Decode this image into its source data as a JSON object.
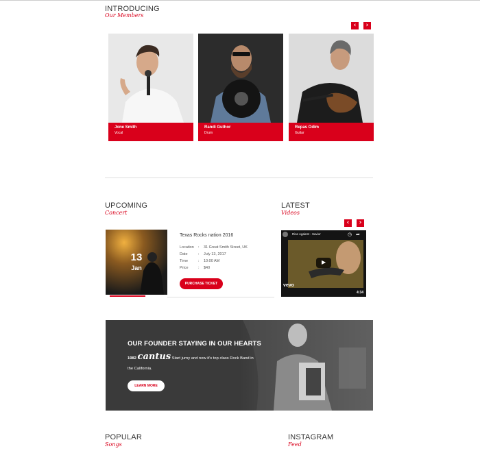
{
  "members": {
    "title": "INTRODUCING",
    "subtitle": "Our Members",
    "prev_icon": "chevron-left-icon",
    "next_icon": "chevron-right-icon",
    "items": [
      {
        "name": "Jone Smith",
        "role": "Vocal"
      },
      {
        "name": "Randi Guthor",
        "role": "Drum"
      },
      {
        "name": "Repas Odim",
        "role": "Guitar"
      }
    ]
  },
  "concert": {
    "title": "UPCOMING",
    "subtitle": "Concert",
    "day": "13",
    "month": "Jan",
    "event_title": "Texas Rocks nation 2016",
    "details": [
      {
        "label": "Location",
        "value": "31 Great Smith Street, UK"
      },
      {
        "label": "Date",
        "value": "July 13, 2017"
      },
      {
        "label": "Time",
        "value": "10:00 AM"
      },
      {
        "label": "Price",
        "value": "$40"
      }
    ],
    "button": "PURCHASE TICKET"
  },
  "videos": {
    "title": "LATEST",
    "subtitle": "Videos",
    "video_title": "Rise Against - Savior",
    "duration": "4:34",
    "logo": "vevo"
  },
  "founder": {
    "title": "OUR FOUNDER STAYING IN OUR HEARTS",
    "year": "1982",
    "brand": "cantus",
    "text_a": "Start jurny and now it's top class Rock Band in",
    "text_b": "the California.",
    "button": "LEARN MORE"
  },
  "songs": {
    "title": "POPULAR",
    "subtitle": "Songs"
  },
  "instagram": {
    "title": "INSTAGRAM",
    "subtitle": "Feed"
  },
  "colors": {
    "accent": "#d9001b",
    "dark": "#3a3a3a"
  }
}
